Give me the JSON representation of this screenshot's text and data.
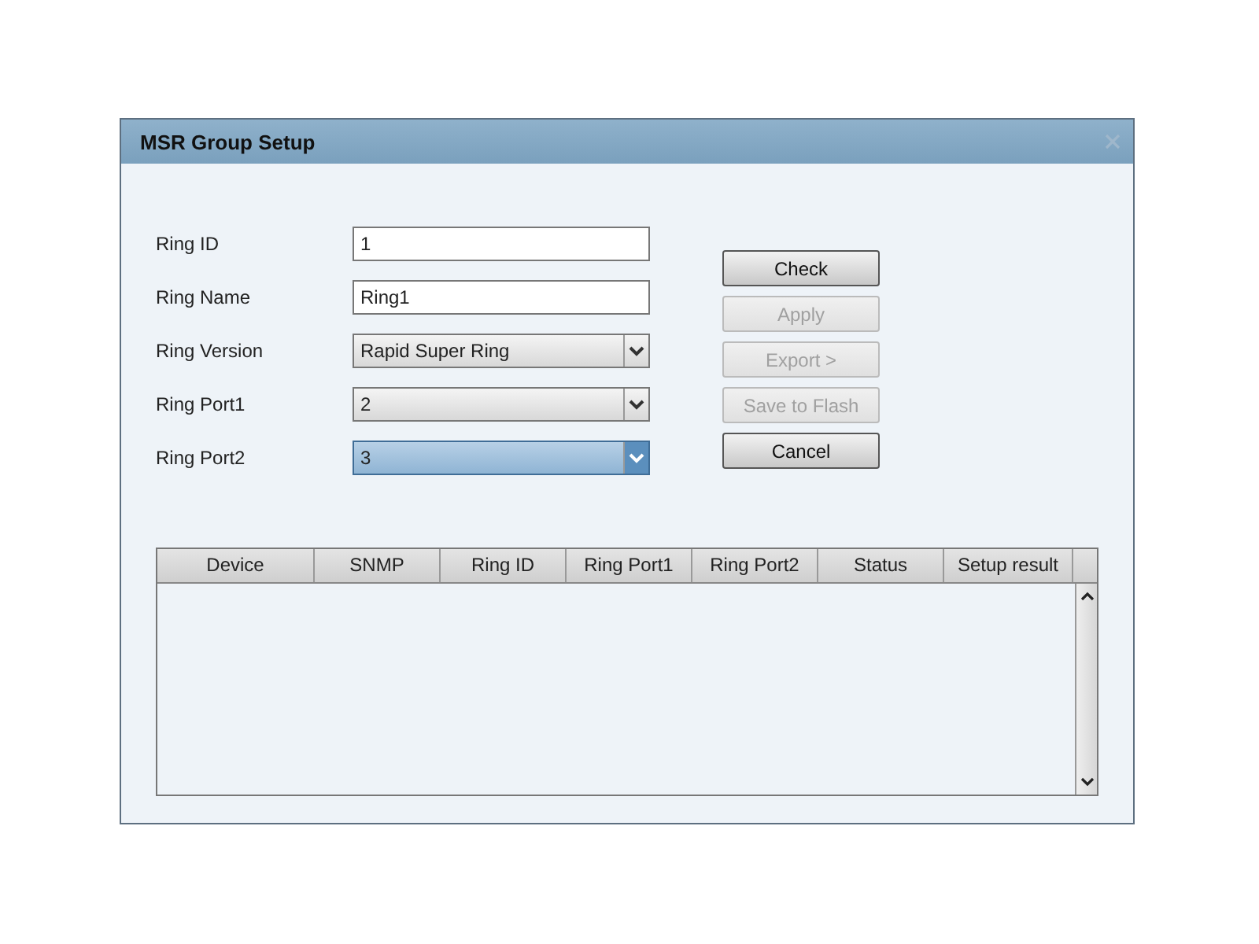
{
  "dialog": {
    "title": "MSR Group Setup"
  },
  "fields": [
    {
      "label": "Ring ID",
      "kind": "input",
      "value": "1",
      "focused": false
    },
    {
      "label": "Ring Name",
      "kind": "input",
      "value": "Ring1",
      "focused": false
    },
    {
      "label": "Ring Version",
      "kind": "select",
      "value": "Rapid Super Ring",
      "focused": false
    },
    {
      "label": "Ring Port1",
      "kind": "select",
      "value": "2",
      "focused": false
    },
    {
      "label": "Ring Port2",
      "kind": "select",
      "value": "3",
      "focused": true
    }
  ],
  "buttons": [
    {
      "label": "Check",
      "disabled": false
    },
    {
      "label": "Apply",
      "disabled": true
    },
    {
      "label": "Export >",
      "disabled": true
    },
    {
      "label": "Save to Flash",
      "disabled": true
    },
    {
      "label": "Cancel",
      "disabled": false
    }
  ],
  "table": {
    "columns": [
      "Device",
      "SNMP",
      "Ring ID",
      "Ring Port1",
      "Ring Port2",
      "Status",
      "Setup result"
    ]
  }
}
